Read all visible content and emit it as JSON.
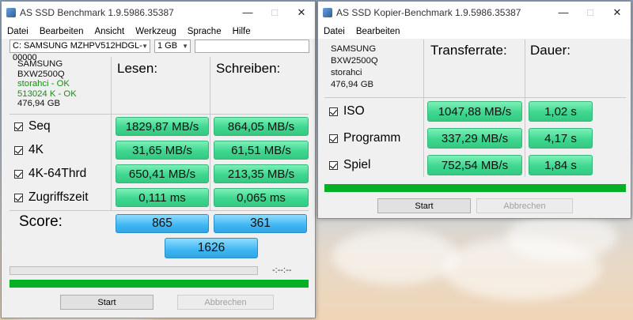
{
  "bench": {
    "title": "AS SSD Benchmark 1.9.5986.35387",
    "menu": [
      "Datei",
      "Bearbeiten",
      "Ansicht",
      "Werkzeug",
      "Sprache",
      "Hilfe"
    ],
    "drive_select": "C: SAMSUNG MZHPV512HDGL-00000",
    "size_select": "1 GB",
    "info": [
      "SAMSUNG",
      "BXW2500Q",
      "storahci - OK",
      "513024 K - OK",
      "476,94 GB"
    ],
    "col_read": "Lesen:",
    "col_write": "Schreiben:",
    "rows": [
      {
        "label": "Seq",
        "read": "1829,87 MB/s",
        "write": "864,05 MB/s"
      },
      {
        "label": "4K",
        "read": "31,65 MB/s",
        "write": "61,51 MB/s"
      },
      {
        "label": "4K-64Thrd",
        "read": "650,41 MB/s",
        "write": "213,35 MB/s"
      },
      {
        "label": "Zugriffszeit",
        "read": "0,111 ms",
        "write": "0,065 ms"
      }
    ],
    "score_label": "Score:",
    "score_read": "865",
    "score_write": "361",
    "score_total": "1626",
    "timer": "-:--:--",
    "progress": 1.0,
    "start_label": "Start",
    "cancel_label": "Abbrechen"
  },
  "copy": {
    "title": "AS SSD Kopier-Benchmark 1.9.5986.35387",
    "menu": [
      "Datei",
      "Bearbeiten"
    ],
    "info": [
      "SAMSUNG",
      "BXW2500Q",
      "storahci",
      "476,94 GB"
    ],
    "col_rate": "Transferrate:",
    "col_time": "Dauer:",
    "rows": [
      {
        "label": "ISO",
        "rate": "1047,88 MB/s",
        "time": "1,02 s"
      },
      {
        "label": "Programm",
        "rate": "337,29 MB/s",
        "time": "4,17 s"
      },
      {
        "label": "Spiel",
        "rate": "752,54 MB/s",
        "time": "1,84 s"
      }
    ],
    "progress": 1.0,
    "start_label": "Start",
    "cancel_label": "Abbrechen"
  },
  "icons": [
    "app-icon",
    "minimize-icon",
    "maximize-icon",
    "close-icon",
    "checkbox-checked-icon",
    "dropdown-arrow-icon"
  ],
  "colors": {
    "result_green": "#3fd78f",
    "score_blue": "#3fb6f2",
    "progress_green": "#06b025"
  }
}
